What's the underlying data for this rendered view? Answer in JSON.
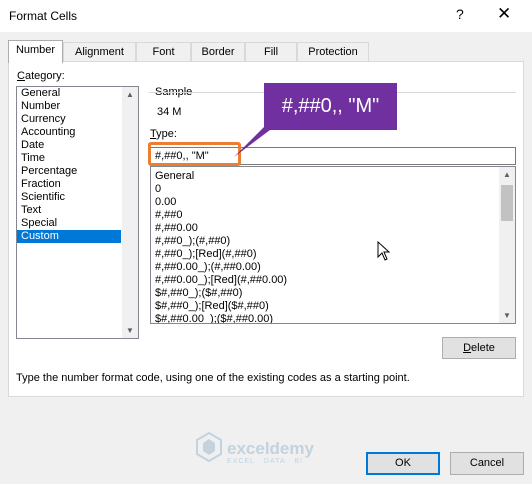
{
  "window": {
    "title": "Format Cells",
    "help_label": "?",
    "close_label": "✕"
  },
  "tabs": [
    {
      "label": "Number",
      "active": true
    },
    {
      "label": "Alignment",
      "active": false
    },
    {
      "label": "Font",
      "active": false
    },
    {
      "label": "Border",
      "active": false
    },
    {
      "label": "Fill",
      "active": false
    },
    {
      "label": "Protection",
      "active": false
    }
  ],
  "category": {
    "label": "Category:",
    "items": [
      "General",
      "Number",
      "Currency",
      "Accounting",
      "Date",
      "Time",
      "Percentage",
      "Fraction",
      "Scientific",
      "Text",
      "Special",
      "Custom"
    ],
    "selected": "Custom"
  },
  "sample": {
    "label": "Sample",
    "value": "34 M"
  },
  "type": {
    "label": "Type:",
    "value": "#,##0,, \"M\"",
    "formats": [
      "General",
      "0",
      "0.00",
      "#,##0",
      "#,##0.00",
      "#,##0_);(#,##0)",
      "#,##0_);[Red](#,##0)",
      "#,##0.00_);(#,##0.00)",
      "#,##0.00_);[Red](#,##0.00)",
      "$#,##0_);($#,##0)",
      "$#,##0_);[Red]($#,##0)",
      "$#,##0.00_);($#,##0.00)"
    ]
  },
  "callout": {
    "text": "#,##0,, \"M\"",
    "color": "#7030a0",
    "highlight_color": "#ed7d31"
  },
  "buttons": {
    "delete": "Delete",
    "ok": "OK",
    "cancel": "Cancel"
  },
  "description": "Type the number format code, using one of the existing codes as a starting point.",
  "watermark": {
    "name": "exceldemy",
    "tagline": "EXCEL · DATA · BI"
  }
}
